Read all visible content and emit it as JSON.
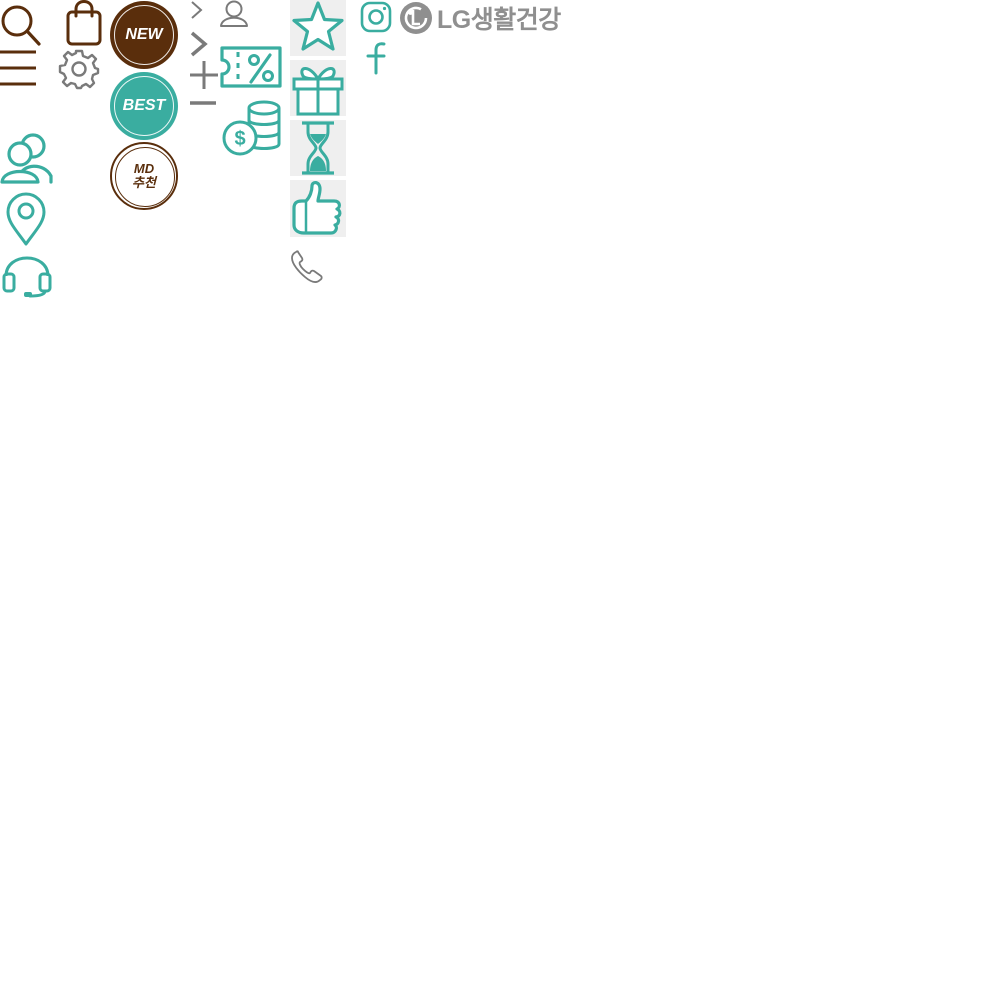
{
  "brand": {
    "name": "LG생활건강"
  },
  "badges": {
    "new": "NEW",
    "best": "BEST",
    "md_line1": "MD",
    "md_line2": "추천"
  },
  "colors": {
    "brown": "#5a2e0c",
    "teal": "#3aada0",
    "gray": "#7a7a7a",
    "tile_bg": "#efefef"
  },
  "icons": [
    "search-icon",
    "shopping-bag-icon",
    "menu-icon",
    "settings-icon",
    "users-icon",
    "location-pin-icon",
    "headset-icon",
    "chevron-right-small-icon",
    "chevron-right-bold-icon",
    "plus-icon",
    "minus-icon",
    "user-outline-icon",
    "coupon-icon",
    "coins-icon",
    "star-icon",
    "gift-icon",
    "hourglass-icon",
    "thumbs-up-icon",
    "phone-icon",
    "instagram-icon",
    "facebook-icon",
    "lg-logo-icon"
  ]
}
